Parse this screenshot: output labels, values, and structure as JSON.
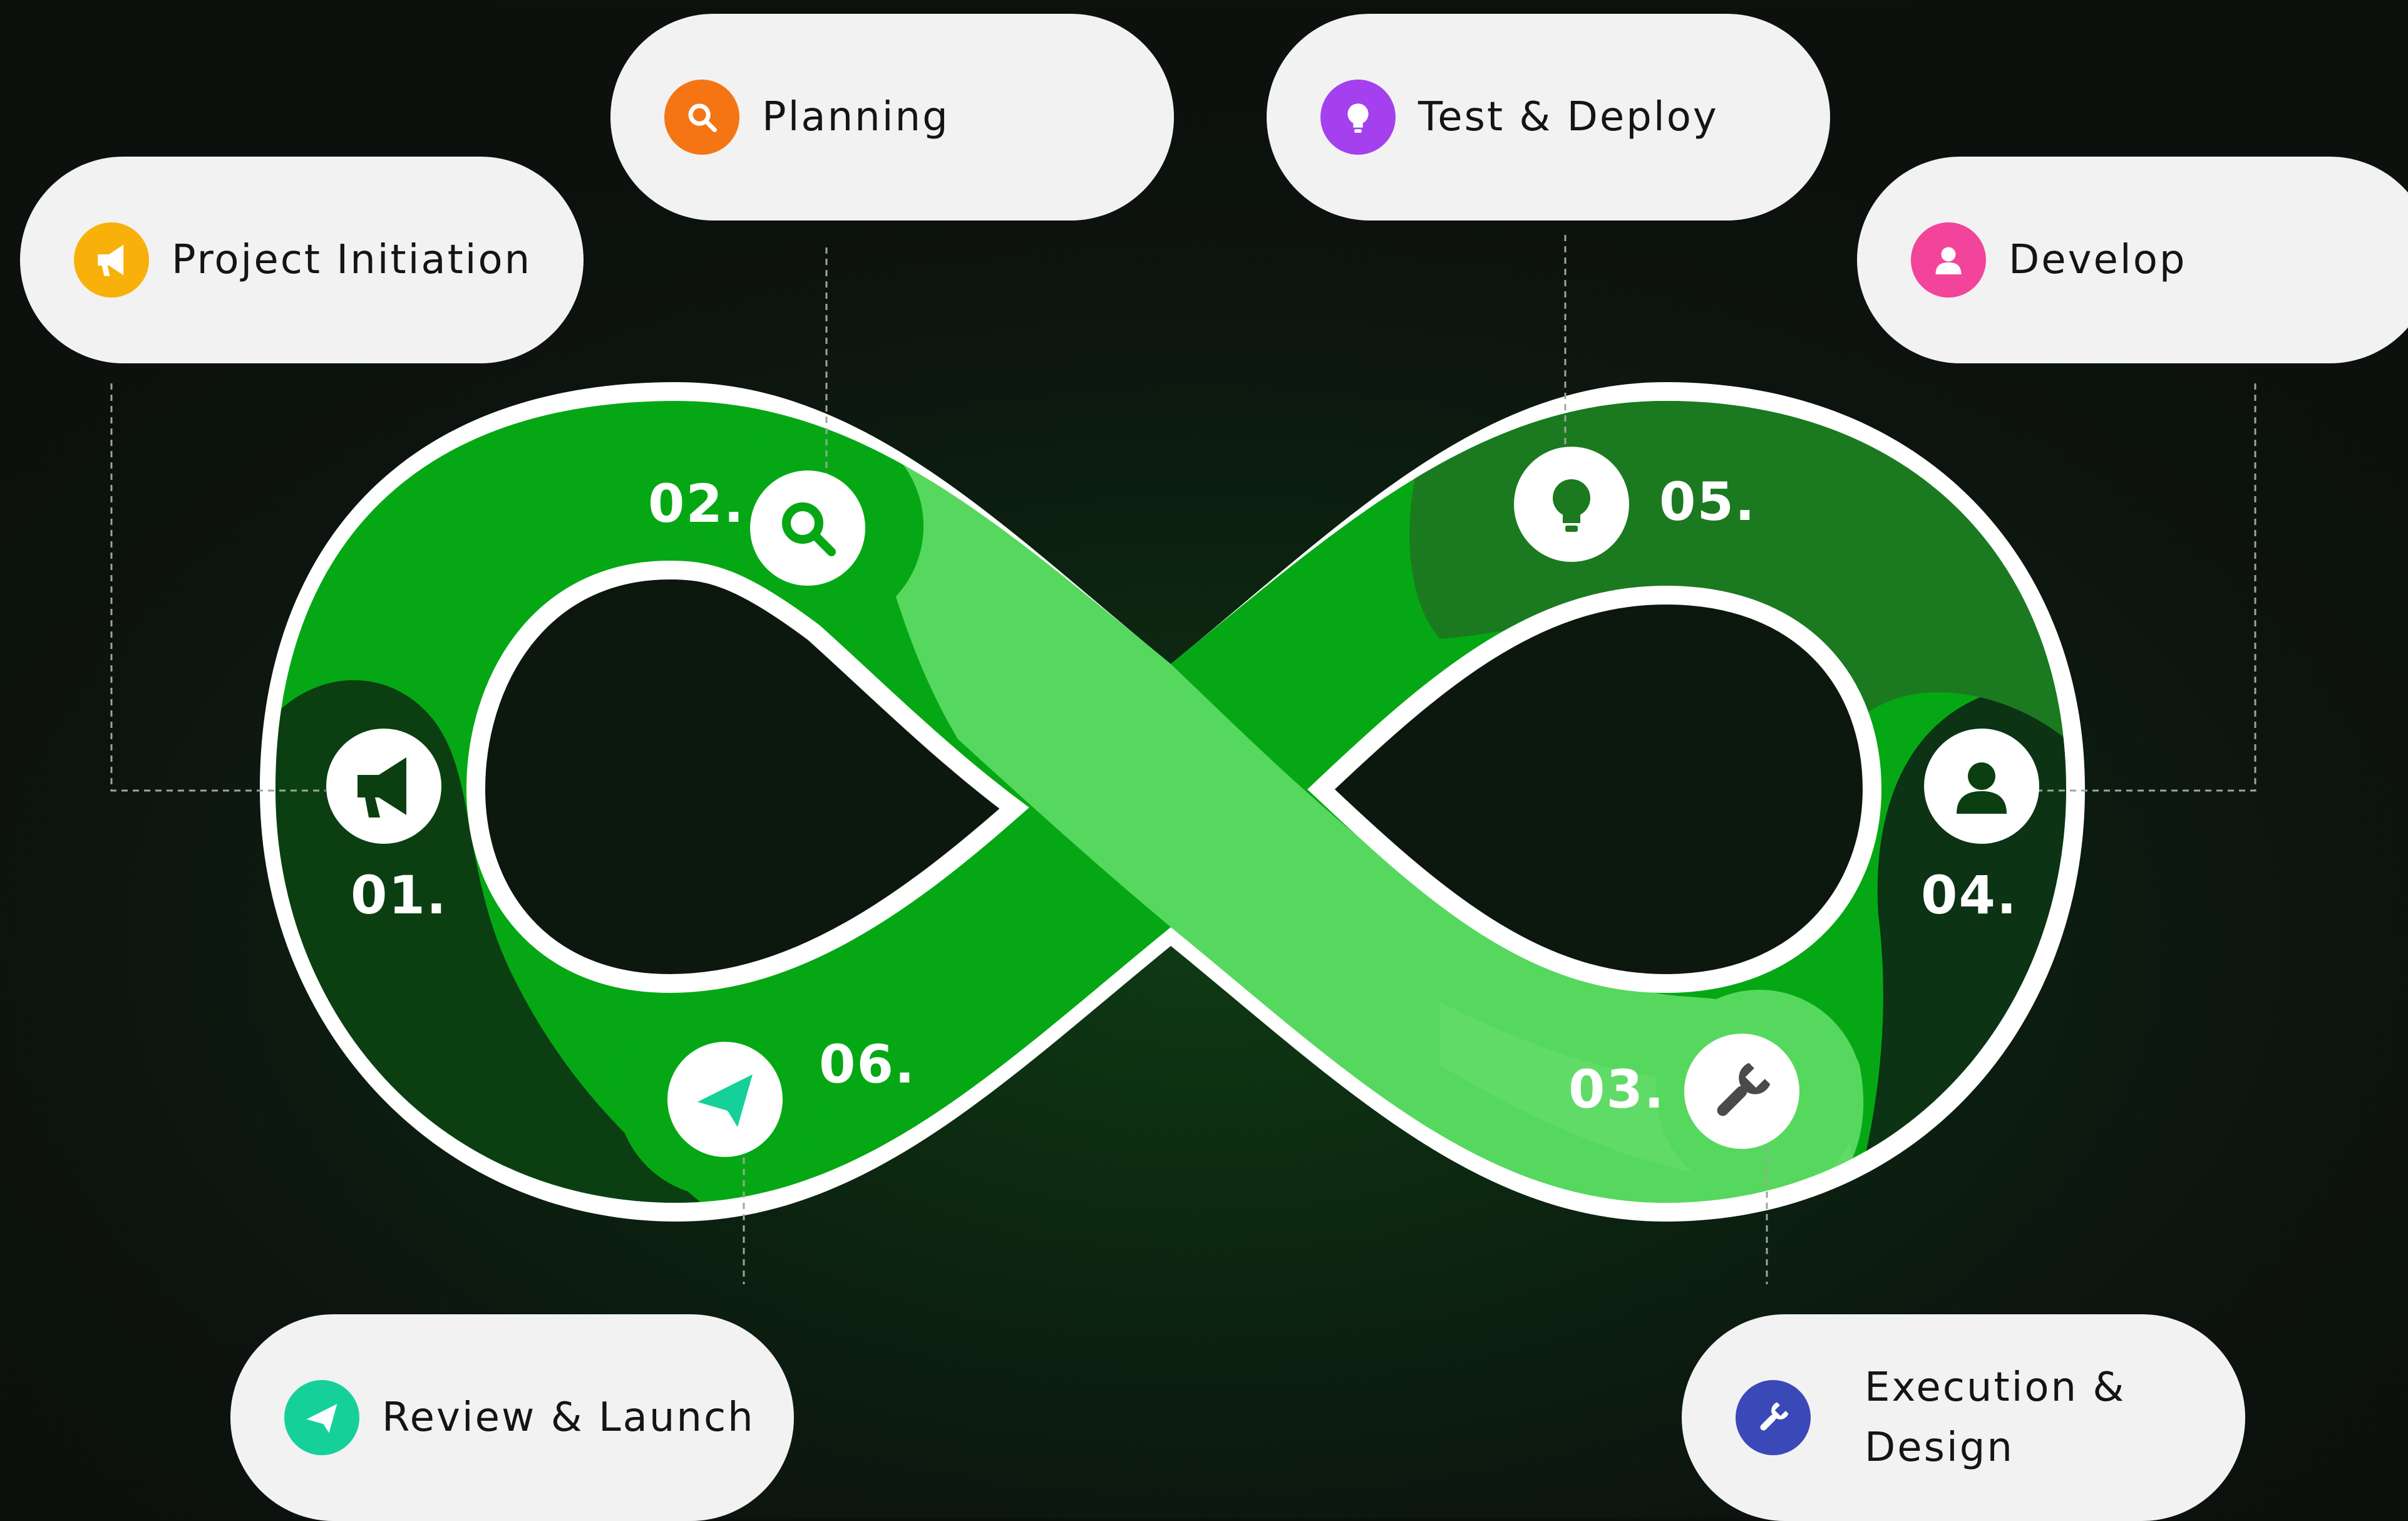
{
  "colors": {
    "background": "#0d130f",
    "loop_outline": "#ffffff",
    "green_bright": "#56d85e",
    "green_mid": "#05a814",
    "green_dark": "#1b7a1f",
    "green_deep": "#0b3f12",
    "pill_bg": "#f2f2f2"
  },
  "stages": [
    {
      "key": "initiation",
      "number": "01.",
      "label": "Project Initiation",
      "icon": "megaphone-icon",
      "color": "#f7b10a"
    },
    {
      "key": "planning",
      "number": "02.",
      "label": "Planning",
      "icon": "search-icon",
      "color": "#f57514"
    },
    {
      "key": "execution",
      "number": "03.",
      "label": "Execution & Design",
      "icon": "wrench-icon",
      "color": "#3b48b8"
    },
    {
      "key": "develop",
      "number": "04.",
      "label": "Develop",
      "icon": "user-icon",
      "color": "#f2449a"
    },
    {
      "key": "deploy",
      "number": "05.",
      "label": "Test & Deploy",
      "icon": "lightbulb-icon",
      "color": "#a440ee"
    },
    {
      "key": "launch",
      "number": "06.",
      "label": "Review & Launch",
      "icon": "paper-plane-icon",
      "color": "#16d09a"
    }
  ]
}
